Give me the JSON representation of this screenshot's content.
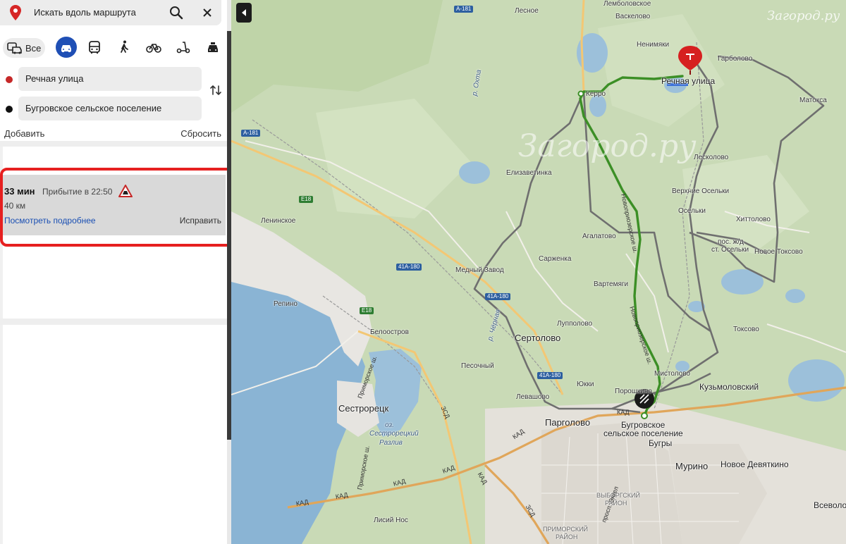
{
  "panel": {
    "search": {
      "placeholder": "Искать вдоль маршрута"
    },
    "modes": {
      "all_label": "Все"
    },
    "waypoints": [
      {
        "label": "Речная улица"
      },
      {
        "label": "Бугровское сельское поселение"
      }
    ],
    "add_label": "Добавить",
    "reset_label": "Сбросить",
    "route": {
      "duration": "33 мин",
      "arrival": "Прибытие в 22:50",
      "distance": "40 км",
      "details_label": "Посмотреть подробнее",
      "fix_label": "Исправить"
    }
  },
  "map": {
    "watermark_big": "Загород.ру",
    "watermark_small": "Загород.ру",
    "places": {
      "lesnoe": "Лесное",
      "vaskelovo": "Васкелово",
      "lembolovskoe": "Лемболовское",
      "nenimyaki": "Ненимяки",
      "garbolovo": "Гарболово",
      "rechnaya": "Речная улица",
      "kerro": "Керро",
      "matoksa": "Матокса",
      "leskolovo": "Лесколово",
      "elizavetinka": "Елизаветинка",
      "verhnie_oselki": "Верхние Осельки",
      "oselki": "Осельки",
      "hittolovo": "Хиттолово",
      "pos_zhd_1": "пос. ж/д",
      "pos_zhd_2": "ст. Осельки",
      "novoe_toksovo": "Новое Токсово",
      "leninskoe": "Ленинское",
      "agalatovo": "Агалатово",
      "sarzhenka": "Сарженка",
      "medny_zavod": "Медный Завод",
      "vartemyagi": "Вартемяги",
      "repino": "Репино",
      "beloostrov": "Белоостров",
      "lupolovo": "Лупполово",
      "sertolovo": "Сертолово",
      "toksovo": "Токсово",
      "pesochny": "Песочный",
      "mistolovo": "Мистолово",
      "kuzmolovsky": "Кузьмоловский",
      "yukki": "Юкки",
      "poroshkino": "Порошкино",
      "sestroretsk": "Сестрорецк",
      "levashovo": "Левашово",
      "pargolovo": "Парголово",
      "bugrovskoe_1": "Бугровское",
      "bugrovskoe_2": "сельское поселение",
      "bugry": "Бугры",
      "murino": "Мурино",
      "novoe_devyatkino": "Новое Девяткино",
      "vsevolozhsk": "Всеволо",
      "lisiy_nos": "Лисий Нос",
      "sestroretsky_1": "оз.",
      "sestroretsky_2": "Сестрорецкий",
      "sestroretsky_3": "Разлив",
      "r_ohta": "р. Охта",
      "r_chernaya": "р. Чёрная",
      "vyborgsky_1": "ВЫБОРГСКИЙ",
      "vyborgsky_2": "РАЙОН",
      "primorsky_1": "ПРИМОРСКИЙ",
      "primorsky_2": "РАЙОН",
      "kad": "КАД",
      "zsd": "ЗСД",
      "primorskoe_sh": "Приморское ш.",
      "novopriozerskoe": "Новоприозерское ш.",
      "prosp_engelsa": "просп. Энгел"
    },
    "shields": {
      "a181_top": "А-181",
      "a181_left": "А-181",
      "e18_a": "E18",
      "e18_b": "E18",
      "a41_1": "41А-180",
      "a41_2": "41А-180",
      "a41_3": "41А-180"
    }
  }
}
